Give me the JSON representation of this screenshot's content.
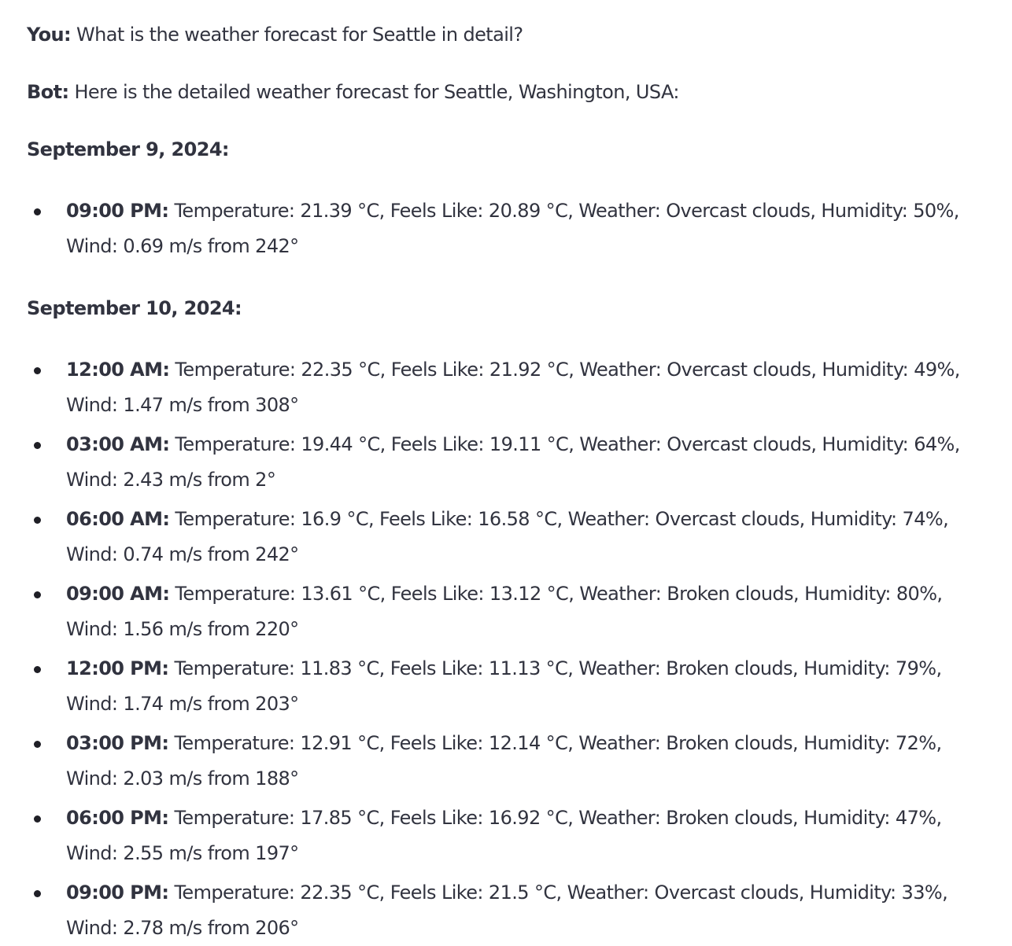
{
  "chat": {
    "user_message": {
      "speaker": "You:",
      "text": " What is the weather forecast for Seattle in detail?"
    },
    "bot_message": {
      "speaker": "Bot:",
      "text": " Here is the detailed weather forecast for Seattle, Washington, USA:"
    },
    "days": [
      {
        "heading": "September 9, 2024:",
        "entries": [
          {
            "time": "09:00 PM:",
            "text": " Temperature: 21.39 °C, Feels Like: 20.89 °C, Weather: Overcast clouds, Humidity: 50%, Wind: 0.69 m/s from 242°"
          }
        ]
      },
      {
        "heading": "September 10, 2024:",
        "entries": [
          {
            "time": "12:00 AM:",
            "text": " Temperature: 22.35 °C, Feels Like: 21.92 °C, Weather: Overcast clouds, Humidity: 49%, Wind: 1.47 m/s from 308°"
          },
          {
            "time": "03:00 AM:",
            "text": " Temperature: 19.44 °C, Feels Like: 19.11 °C, Weather: Overcast clouds, Humidity: 64%, Wind: 2.43 m/s from 2°"
          },
          {
            "time": "06:00 AM:",
            "text": " Temperature: 16.9 °C, Feels Like: 16.58 °C, Weather: Overcast clouds, Humidity: 74%, Wind: 0.74 m/s from 242°"
          },
          {
            "time": "09:00 AM:",
            "text": " Temperature: 13.61 °C, Feels Like: 13.12 °C, Weather: Broken clouds, Humidity: 80%, Wind: 1.56 m/s from 220°"
          },
          {
            "time": "12:00 PM:",
            "text": " Temperature: 11.83 °C, Feels Like: 11.13 °C, Weather: Broken clouds, Humidity: 79%, Wind: 1.74 m/s from 203°"
          },
          {
            "time": "03:00 PM:",
            "text": " Temperature: 12.91 °C, Feels Like: 12.14 °C, Weather: Broken clouds, Humidity: 72%, Wind: 2.03 m/s from 188°"
          },
          {
            "time": "06:00 PM:",
            "text": " Temperature: 17.85 °C, Feels Like: 16.92 °C, Weather: Broken clouds, Humidity: 47%, Wind: 2.55 m/s from 197°"
          },
          {
            "time": "09:00 PM:",
            "text": " Temperature: 22.35 °C, Feels Like: 21.5 °C, Weather: Overcast clouds, Humidity: 33%, Wind: 2.78 m/s from 206°"
          }
        ]
      }
    ]
  }
}
